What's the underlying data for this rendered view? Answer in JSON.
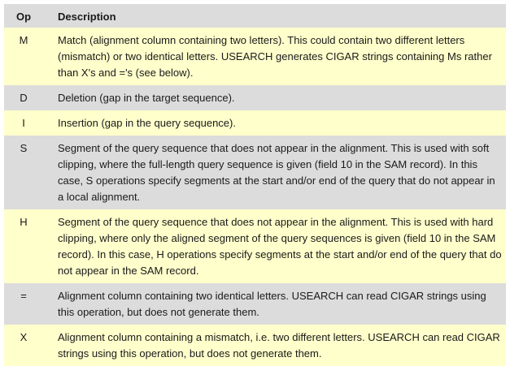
{
  "header": {
    "op": "Op",
    "description": "Description"
  },
  "rows": [
    {
      "op": "M",
      "description": "Match (alignment column containing two letters). This could contain two different letters (mismatch) or two identical letters. USEARCH generates CIGAR strings containing Ms rather than X's and ='s (see below)."
    },
    {
      "op": "D",
      "description": "Deletion (gap in the target sequence)."
    },
    {
      "op": "I",
      "description": "Insertion (gap in the query sequence)."
    },
    {
      "op": "S",
      "description": "Segment of the query sequence that does not appear in the alignment. This is used with soft clipping, where the full-length query sequence is given (field 10 in the SAM record). In this case, S operations specify segments at the start and/or end of the query that do not appear in a local alignment."
    },
    {
      "op": "H",
      "description": "Segment of the query sequence that does not appear in the alignment. This is used with hard clipping, where only the aligned segment of the query sequences is given (field 10 in the SAM record). In this case, H operations specify segments at the start and/or end of the query that do not appear in the SAM record."
    },
    {
      "op": "=",
      "description": "Alignment column containing two identical letters. USEARCH can read CIGAR strings using this operation, but does not generate them."
    },
    {
      "op": "X",
      "description": "Alignment column containing a mismatch, i.e. two different letters. USEARCH can read CIGAR strings using this operation, but does not generate them."
    }
  ],
  "colors": {
    "header_bg": "#dcdcdc",
    "row_light": "#ffffcc",
    "row_dark": "#dcdcdc"
  }
}
